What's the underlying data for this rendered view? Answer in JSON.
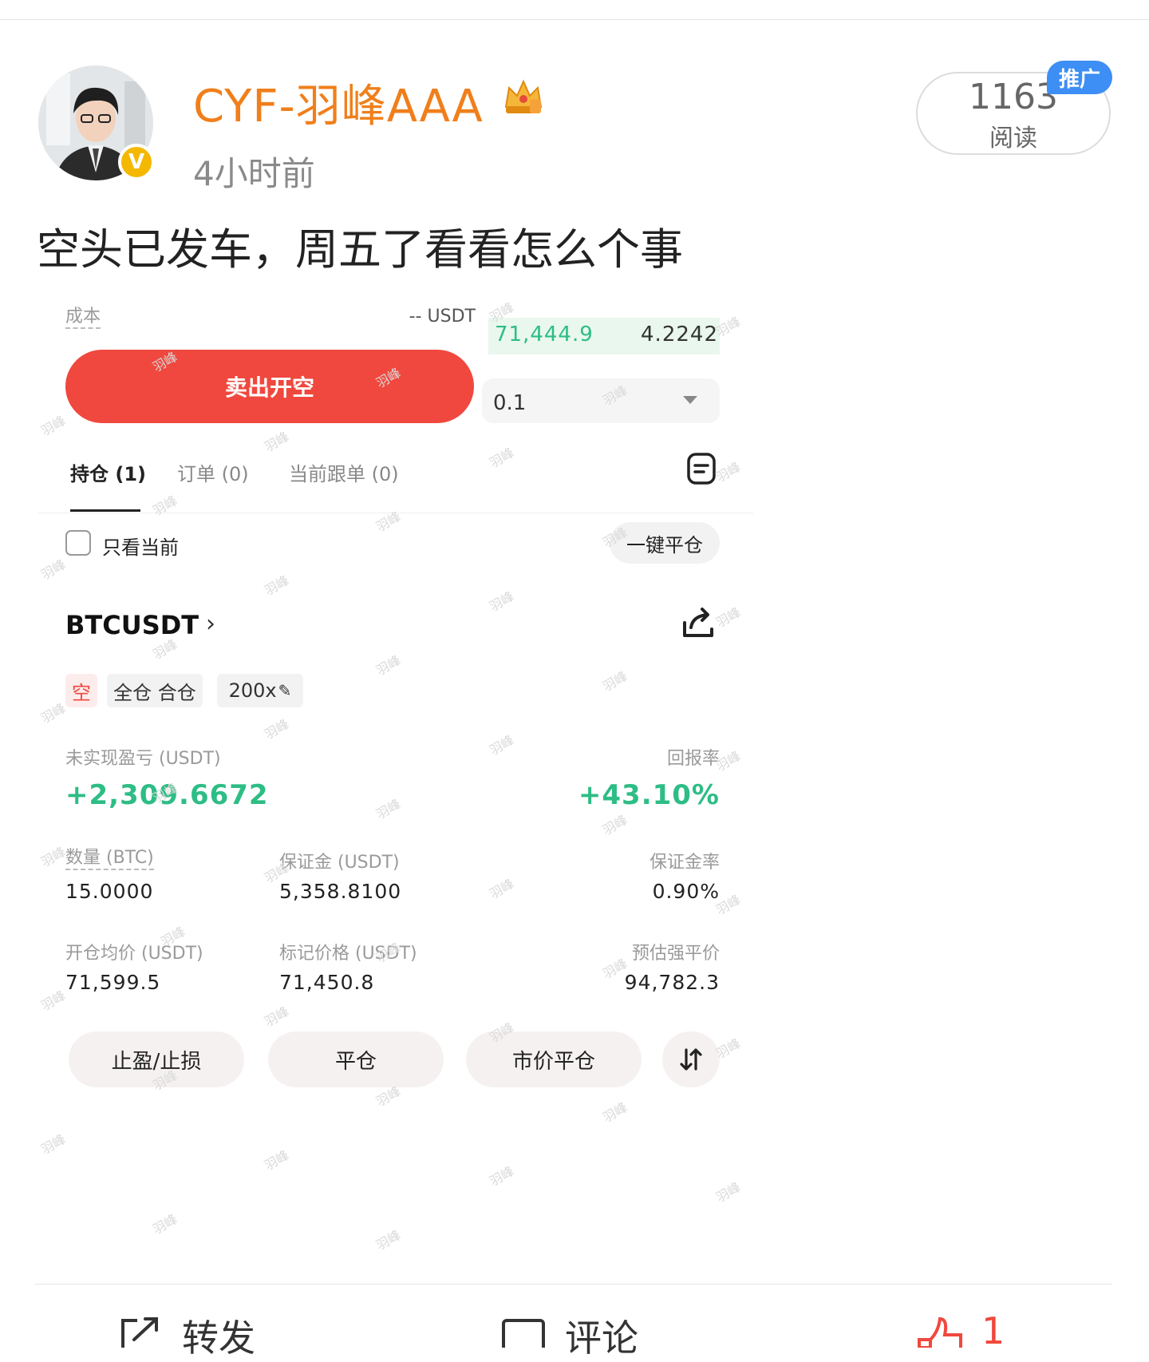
{
  "post": {
    "username": "CYF-羽峰AAA",
    "time": "4小时前",
    "read_count": "1163",
    "read_label": "阅读",
    "promo_badge": "推广",
    "text": "空头已发车，周五了看看怎么个事"
  },
  "trade": {
    "cost_label": "成本",
    "cost_value": "-- USDT",
    "orderbook": {
      "price": "71,444.9",
      "qty": "4.2242"
    },
    "sell_button": "卖出开空",
    "qty_select": "0.1",
    "tabs": [
      {
        "label": "持仓 (1)",
        "active": true
      },
      {
        "label": "订单 (0)",
        "active": false
      },
      {
        "label": "当前跟单 (0)",
        "active": false
      }
    ],
    "only_current": "只看当前",
    "close_all": "一键平仓",
    "symbol": "BTCUSDT",
    "tags": {
      "side": "空",
      "margin_mode": "全仓 合仓",
      "leverage": "200x"
    },
    "pnl_label": "未实现盈亏 (USDT)",
    "pnl_value": "+2,309.6672",
    "roe_label": "回报率",
    "roe_value": "+43.10%",
    "fields": {
      "qty_label": "数量 (BTC)",
      "qty_value": "15.0000",
      "margin_label": "保证金 (USDT)",
      "margin_value": "5,358.8100",
      "margin_rate_label": "保证金率",
      "margin_rate_value": "0.90%",
      "entry_label": "开仓均价 (USDT)",
      "entry_value": "71,599.5",
      "mark_label": "标记价格 (USDT)",
      "mark_value": "71,450.8",
      "liq_label": "预估强平价",
      "liq_value": "94,782.3"
    },
    "actions": {
      "tp_sl": "止盈/止损",
      "close": "平仓",
      "market_close": "市价平仓"
    },
    "watermark": "羽峰"
  },
  "bottom_bar": {
    "repost": "转发",
    "comment": "评论",
    "like_count": "1"
  },
  "colors": {
    "username": "#f07f1b",
    "sell": "#f0483e",
    "profit": "#2dbd85",
    "promo": "#3d8ef5"
  }
}
